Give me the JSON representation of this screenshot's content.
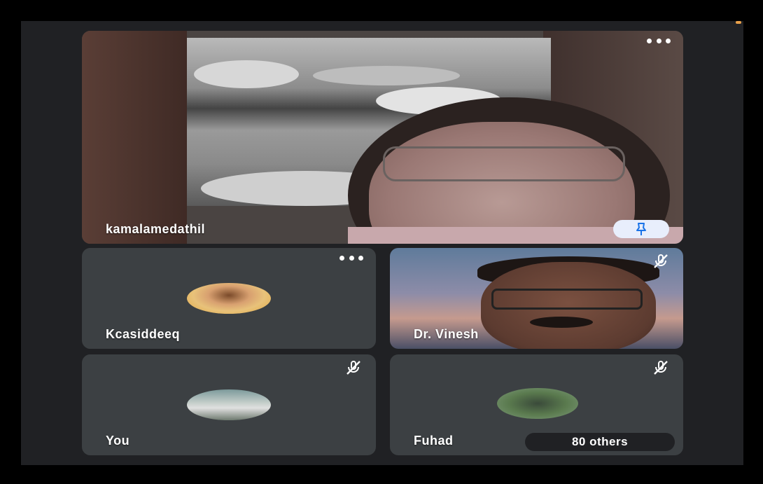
{
  "participants": {
    "main": {
      "name": "kamalamedathil",
      "pin_icon": "pin-icon",
      "more_icon": "more-options-icon"
    },
    "tiles": [
      {
        "name": "Kcasiddeeq",
        "more_icon": "more-options-icon",
        "avatar_icon": "avatar-photo"
      },
      {
        "name": "Dr. Vinesh",
        "mic_icon": "mic-off-icon"
      },
      {
        "name": "You",
        "mic_icon": "mic-off-icon",
        "avatar_icon": "avatar-photo"
      },
      {
        "name": "Fuhad",
        "mic_icon": "mic-off-icon",
        "avatar_icon": "avatar-photo",
        "others_label": "80 others"
      }
    ]
  },
  "colors": {
    "tile_bg": "#3c4043",
    "screen_bg": "#202124",
    "pin_bg": "#e8eefc",
    "pin_icon": "#1a73e8"
  }
}
